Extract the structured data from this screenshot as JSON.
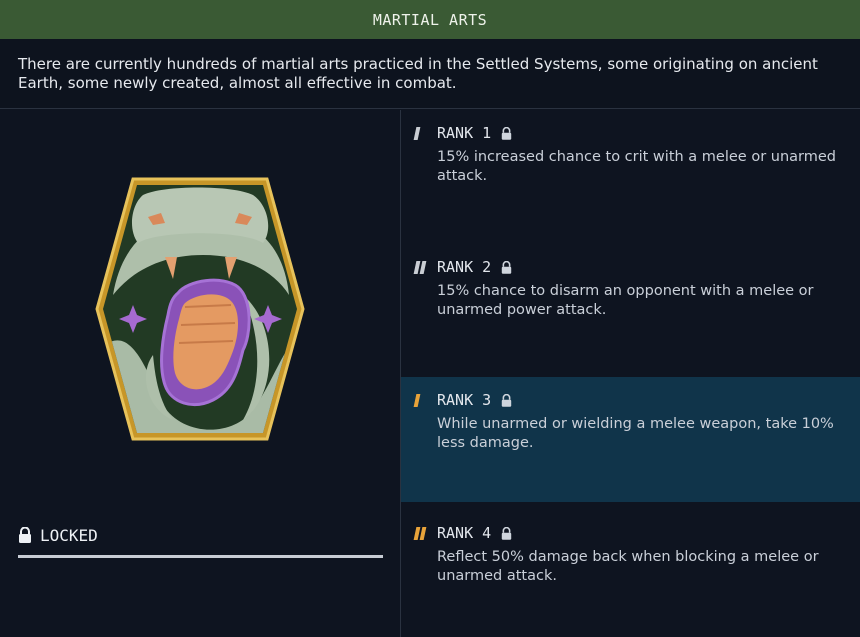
{
  "header": {
    "title": "MARTIAL ARTS"
  },
  "description": "There are currently hundreds of martial arts practiced in the Settled Systems, some originating on ancient Earth, some newly created, almost all effective in combat.",
  "status": {
    "label": "LOCKED"
  },
  "ranks": [
    {
      "label": "RANK 1",
      "text": "15% increased chance to crit with a melee or unarmed attack.",
      "pips": 1,
      "pip_color": "#c9cdd3"
    },
    {
      "label": "RANK 2",
      "text": "15% chance to disarm an opponent with a melee or unarmed power attack.",
      "pips": 2,
      "pip_color": "#c9cdd3"
    },
    {
      "label": "RANK 3",
      "text": "While unarmed or wielding a melee weapon, take 10% less damage.",
      "pips": 1,
      "pip_color": "#e8a33a"
    },
    {
      "label": "RANK 4",
      "text": "Reflect 50% damage back when blocking a melee or unarmed attack.",
      "pips": 2,
      "pip_color": "#e8a33a"
    }
  ],
  "colors": {
    "header_bg": "#3a5a34",
    "highlight_bg": "#10344a",
    "silver_tier": "#c9cdd3",
    "gold_tier": "#e8a33a"
  },
  "icons": {
    "lock": "lock-icon",
    "badge": "martial-arts-badge"
  }
}
